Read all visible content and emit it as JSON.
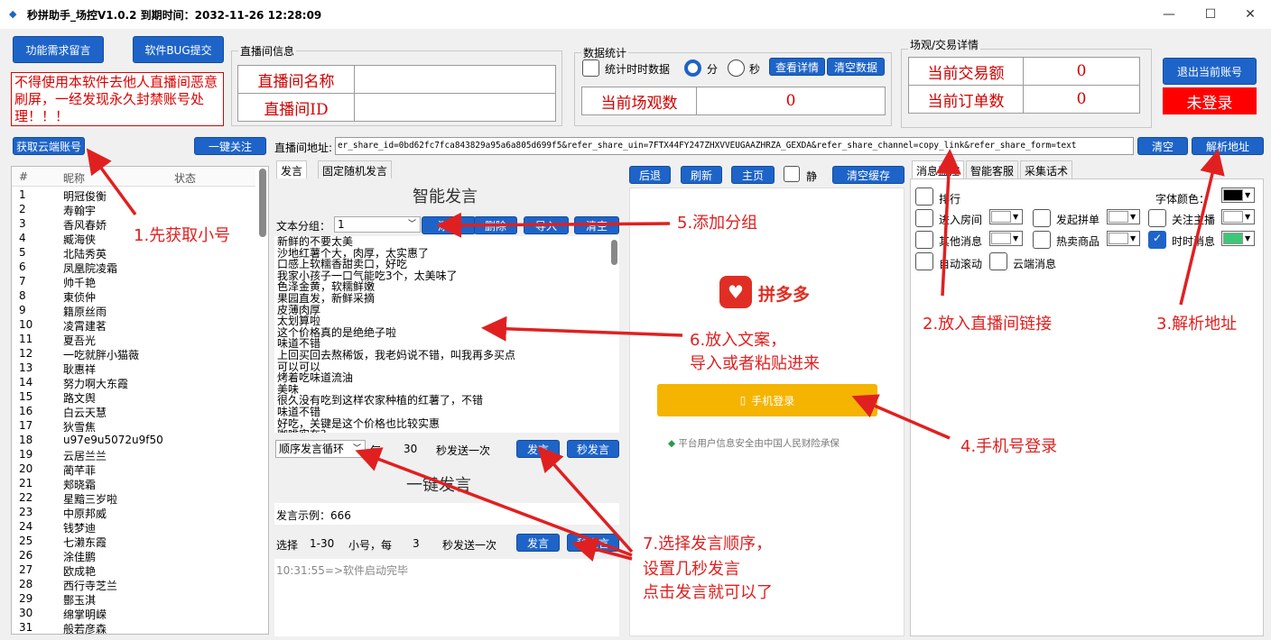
{
  "app": {
    "title": "秒拼助手_场控V1.0.2  到期时间：2032-11-26 12:28:09"
  },
  "window": {
    "minimize": "—",
    "maximize": "☐",
    "close": "✕"
  },
  "top_buttons": {
    "feature": "功能需求留言",
    "bug": "软件BUG提交"
  },
  "notice": "不得使用本软件去他人直播间恶意刷屏，一经发现永久封禁账号处理！！！",
  "live_room": {
    "group_title": "直播间信息",
    "name_label": "直播间名称",
    "name_value": "",
    "id_label": "直播间ID",
    "id_value": ""
  },
  "stats": {
    "group_title": "数据统计",
    "timer_label": "统计时时数据",
    "min_label": "分",
    "sec_label": "秒",
    "detail_btn": "查看详情",
    "clear_btn": "清空数据",
    "views_label": "当前场观数",
    "views_value": "0"
  },
  "trade": {
    "group_title": "场观/交易详情",
    "amount_label": "当前交易额",
    "amount_value": "0",
    "orders_label": "当前订单数",
    "orders_value": "0"
  },
  "account": {
    "logout_btn": "退出当前账号",
    "status": "未登录"
  },
  "toolbar": {
    "get_accounts": "获取云端账号",
    "follow_all": "一键关注",
    "url_label": "直播间地址:",
    "url_value": "er_share_id=0bd62fc7fca843829a95a6a805d699f5&refer_share_uin=7FTX44FY247ZHXVVEUGAAZHRZA_GEXDA&refer_share_channel=copy_link&refer_share_form=text",
    "clear_btn": "清空",
    "parse_btn": "解析地址"
  },
  "accounts": {
    "headers": [
      "#",
      "昵称",
      "状态"
    ],
    "rows": [
      [
        "1",
        "明冠俊衡"
      ],
      [
        "2",
        "寿翰宇"
      ],
      [
        "3",
        "香风春娇"
      ],
      [
        "4",
        "臧海侠"
      ],
      [
        "5",
        "北陆秀英"
      ],
      [
        "6",
        "凤凰院凌霜"
      ],
      [
        "7",
        "帅千艳"
      ],
      [
        "8",
        "東侦仲"
      ],
      [
        "9",
        "籍原丝雨"
      ],
      [
        "10",
        "凌霄建茗"
      ],
      [
        "11",
        "夏吾光"
      ],
      [
        "12",
        "一吃就胖小猫薇"
      ],
      [
        "13",
        "耿惠祥"
      ],
      [
        "14",
        "努力啊大东霞"
      ],
      [
        "15",
        "路文舆"
      ],
      [
        "16",
        "白云天慧"
      ],
      [
        "17",
        "狄雪焦"
      ],
      [
        "18",
        "u97e9u5072u9f50"
      ],
      [
        "19",
        "云居兰兰"
      ],
      [
        "20",
        "蔺芊菲"
      ],
      [
        "21",
        "郏晓霜"
      ],
      [
        "22",
        "星黯三岁啦"
      ],
      [
        "23",
        "中原邦威"
      ],
      [
        "24",
        "钱梦迪"
      ],
      [
        "25",
        "七濑东霞"
      ],
      [
        "26",
        "涂佳鹏"
      ],
      [
        "27",
        "欧成艳"
      ],
      [
        "28",
        "西行寺芝兰"
      ],
      [
        "29",
        "酆玉淇"
      ],
      [
        "30",
        "绵掌明嵘"
      ],
      [
        "31",
        "般若彦森"
      ]
    ]
  },
  "speech": {
    "tabs": [
      "发言",
      "固定随机发言"
    ],
    "title": "智能发言",
    "group_label": "文本分组：",
    "group_value": "1",
    "add_btn": "添加",
    "delete_btn": "删除",
    "import_btn": "导入",
    "clear_btn": "清空",
    "messages": [
      "新鲜的不要太美",
      "沙地红薯个大，肉厚，太实惠了",
      "口感上软糯香甜卖口，好吃",
      "我家小孩子一口气能吃3个，太美味了",
      "色泽金黄，软糯鲜嫩",
      "果园直发，新鲜采摘",
      "皮薄肉厚",
      "太划算啦",
      "这个价格真的是绝绝子啦",
      "味道不错",
      "上回买回去熬稀饭，我老妈说不错，叫我再多买点",
      "可以可以",
      "烤着吃味道流油",
      "美味",
      "很久没有吃到这样农家种植的红薯了，不错",
      "味道不错",
      "好吃，关键是这个价格也比较实惠",
      "咖啡实在？"
    ],
    "order_value": "顺序发言循环",
    "every_label": "每",
    "interval": "30",
    "per_label": "秒发送一次",
    "send_btn": "发言",
    "sec_send_btn": "秒发言",
    "one_key_title": "一键发言",
    "example": "发言示例：666",
    "select_label": "选择",
    "range": "1-30",
    "sub_label": "小号，每",
    "sub_interval": "3",
    "sub_per_label": "秒发送一次",
    "log": "10:31:55=>软件启动完毕"
  },
  "browser": {
    "back": "后退",
    "refresh": "刷新",
    "home": "主页",
    "mute": "静",
    "clear_cache": "清空缓存",
    "brand": "拼多多",
    "phone_login": "手机登录",
    "security_note": "平台用户信息安全由中国人民财险承保"
  },
  "monitor": {
    "tabs": [
      "消息监控",
      "智能客服",
      "采集话术"
    ],
    "rank": "排行",
    "font_color_label": "字体颜色：",
    "enter_room": "进入房间",
    "start_group": "发起拼单",
    "follow_anchor": "关注主播",
    "other_msg": "其他消息",
    "hot_goods": "热卖商品",
    "realtime_msg": "时时消息",
    "auto_scroll": "自动滚动",
    "cloud_msg": "云端消息",
    "colors": {
      "font": "#000000",
      "enter": "#ffffff",
      "group": "#ffffff",
      "follow": "#ffffff",
      "other": "#ffffff",
      "hot": "#ffffff",
      "realtime": "#3cc878"
    }
  },
  "annotations": {
    "a1": "1.先获取小号",
    "a2": "2.放入直播间链接",
    "a3": "3.解析地址",
    "a4": "4.手机号登录",
    "a5": "5.添加分组",
    "a6_1": "6.放入文案，",
    "a6_2": "导入或者粘贴进来",
    "a7_1": "7.选择发言顺序，",
    "a7_2": "设置几秒发言",
    "a7_3": "点击发言就可以了"
  }
}
